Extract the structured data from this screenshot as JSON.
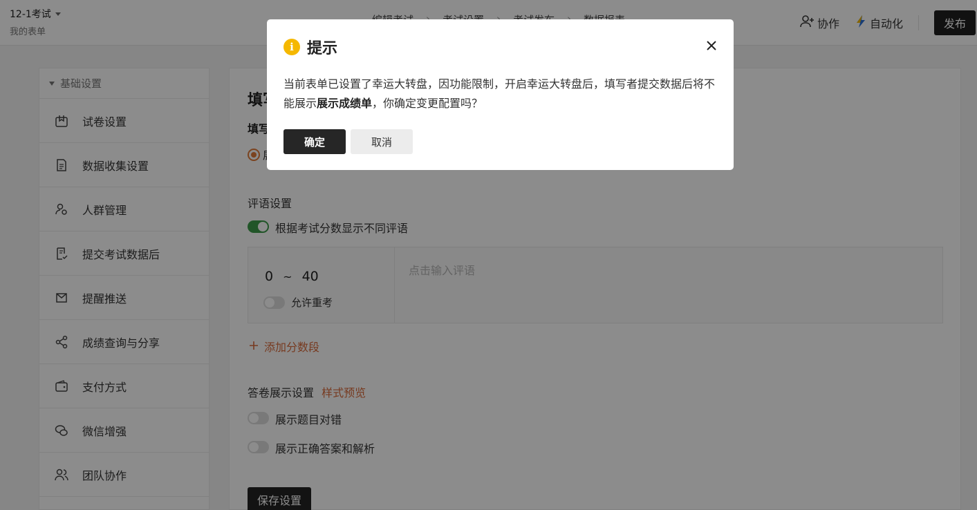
{
  "header": {
    "form_title": "12-1考试",
    "form_subtitle": "我的表单",
    "steps": [
      "编辑考试",
      "考试设置",
      "考试发布",
      "数据报表"
    ],
    "collab_label": "协作",
    "automation_label": "自动化",
    "publish_label": "发布"
  },
  "sidebar": {
    "section_title": "基础设置",
    "items": [
      {
        "label": "试卷设置",
        "icon": "exam-icon"
      },
      {
        "label": "数据收集设置",
        "icon": "document-icon"
      },
      {
        "label": "人群管理",
        "icon": "user-settings-icon"
      },
      {
        "label": "提交考试数据后",
        "icon": "submit-doc-icon"
      },
      {
        "label": "提醒推送",
        "icon": "mail-send-icon"
      },
      {
        "label": "成绩查询与分享",
        "icon": "share-icon"
      },
      {
        "label": "支付方式",
        "icon": "wallet-icon"
      },
      {
        "label": "微信增强",
        "icon": "wechat-icon"
      },
      {
        "label": "团队协作",
        "icon": "team-icon"
      }
    ]
  },
  "main": {
    "title": "填写",
    "sub_title": "填写",
    "radio_label": "展",
    "comment_section": "评语设置",
    "comment_toggle_label": "根据考试分数显示不同评语",
    "score_range": {
      "from": "0",
      "tilde": "~",
      "to": "40"
    },
    "retake_label": "允许重考",
    "comment_placeholder": "点击输入评语",
    "add_range_label": "添加分数段",
    "display_section": "答卷展示设置",
    "preview_link": "样式预览",
    "show_correctness_label": "展示题目对错",
    "show_answers_label": "展示正确答案和解析",
    "save_label": "保存设置"
  },
  "dialog": {
    "title": "提示",
    "body_part1": "当前表单已设置了幸运大转盘，因功能限制，开启幸运大转盘后，填写者提交数据后将不能展示",
    "body_bold": "展示成绩单",
    "body_part2": "，你确定变更配置吗？",
    "confirm_label": "确定",
    "cancel_label": "取消"
  },
  "colors": {
    "accent_orange": "#d96b3b",
    "toggle_on": "#3d9c4a",
    "info_yellow": "#f5b800",
    "dark_button": "#262626"
  }
}
